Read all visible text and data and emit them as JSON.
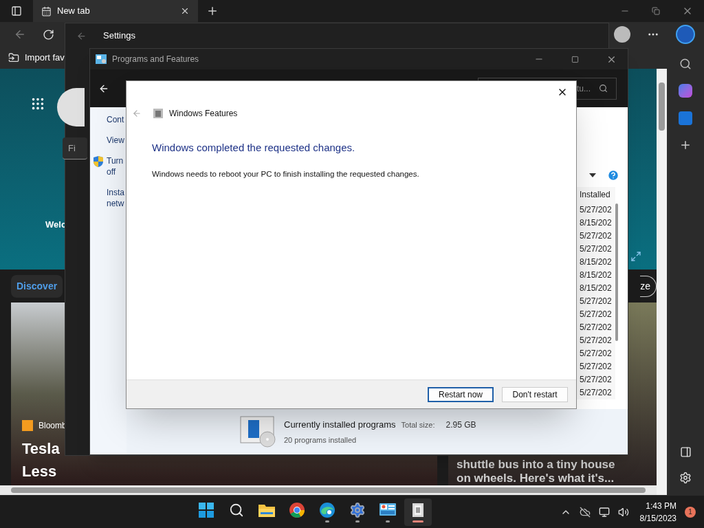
{
  "browser": {
    "tab": {
      "title": "New tab",
      "selected": true
    },
    "favorites_bar": {
      "item": "Import fav"
    },
    "page": {
      "welcome": "Welc",
      "discover_tab": "Discover",
      "personalize_button": "ze",
      "story_left": {
        "source": "Bloomb",
        "headline_lines": [
          "Tesla",
          "Less"
        ]
      },
      "story_right": {
        "headline_lines": [
          "shuttle bus into a tiny house",
          "on wheels. Here's what it's..."
        ]
      }
    }
  },
  "settings_window": {
    "title": "Settings",
    "search_placeholder": "Fi"
  },
  "programs_window": {
    "title": "Programs and Features",
    "search_placeholder": "tu...",
    "left_pane": [
      {
        "lines": [
          "Cont"
        ],
        "shield": false
      },
      {
        "lines": [
          "View"
        ],
        "shield": false
      },
      {
        "lines": [
          "Turn",
          "off"
        ],
        "shield": true
      },
      {
        "lines": [
          "Insta",
          "netw"
        ],
        "shield": false
      }
    ],
    "column_header": "Installed",
    "rows": [
      "5/27/202",
      "8/15/202",
      "5/27/202",
      "5/27/202",
      "8/15/202",
      "8/15/202",
      "8/15/202",
      "5/27/202",
      "5/27/202",
      "5/27/202",
      "5/27/202",
      "5/27/202",
      "5/27/202",
      "5/27/202",
      "5/27/202"
    ],
    "status": {
      "title": "Currently installed programs",
      "size_label": "Total size:",
      "size": "2.95 GB",
      "count": "20 programs installed"
    }
  },
  "dialog": {
    "title": "Windows Features",
    "heading": "Windows completed the requested changes.",
    "message": "Windows needs to reboot your PC to finish installing the requested changes.",
    "buttons": [
      {
        "label": "Restart now",
        "default": true
      },
      {
        "label": "Don't restart",
        "default": false
      }
    ]
  },
  "taskbar": {
    "apps": [
      {
        "kind": "start",
        "running": false,
        "active": false
      },
      {
        "kind": "search",
        "running": false,
        "active": false
      },
      {
        "kind": "explorer",
        "running": false,
        "active": false
      },
      {
        "kind": "chrome",
        "running": false,
        "active": false
      },
      {
        "kind": "edge",
        "running": true,
        "active": false
      },
      {
        "kind": "settings",
        "running": true,
        "active": false
      },
      {
        "kind": "control-panel",
        "running": true,
        "active": false
      },
      {
        "kind": "features",
        "running": true,
        "active": true
      }
    ],
    "time": "1:43 PM",
    "date": "8/15/2023",
    "notifications": "1"
  }
}
